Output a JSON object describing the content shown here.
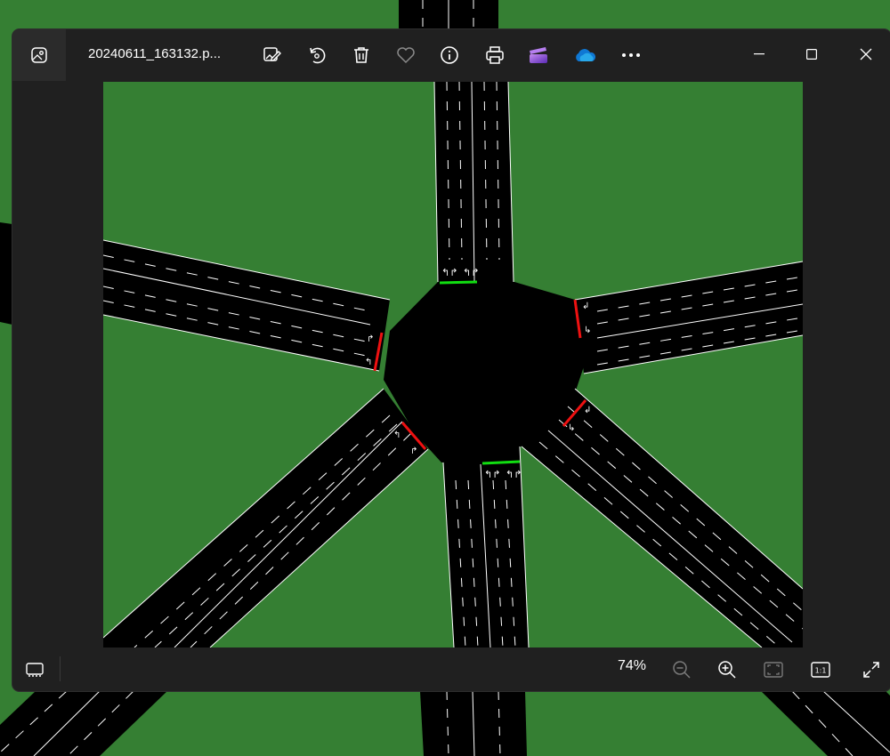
{
  "window": {
    "file_name": "20240611_163132.p...",
    "zoom_level": "74%"
  },
  "toolbar": {
    "icons": [
      "edit-image-icon",
      "rotate-icon",
      "delete-icon",
      "favorite-icon",
      "info-icon",
      "print-icon",
      "clipchamp-icon",
      "onedrive-icon",
      "more-icon"
    ]
  },
  "window_controls": [
    "minimize-icon",
    "maximize-icon",
    "close-icon"
  ],
  "bottom_bar": {
    "icons": [
      "filmstrip-icon",
      "zoom-out-icon",
      "zoom-in-icon",
      "fit-to-window-icon",
      "actual-size-icon",
      "fullscreen-icon"
    ],
    "actual_size_label": "1:1"
  },
  "colors": {
    "grass": "#357f33",
    "road": "#000000",
    "lane_marking": "#ffffff",
    "signal_red": "#ee1111",
    "signal_green": "#11dd11",
    "window_bg": "#202020"
  }
}
